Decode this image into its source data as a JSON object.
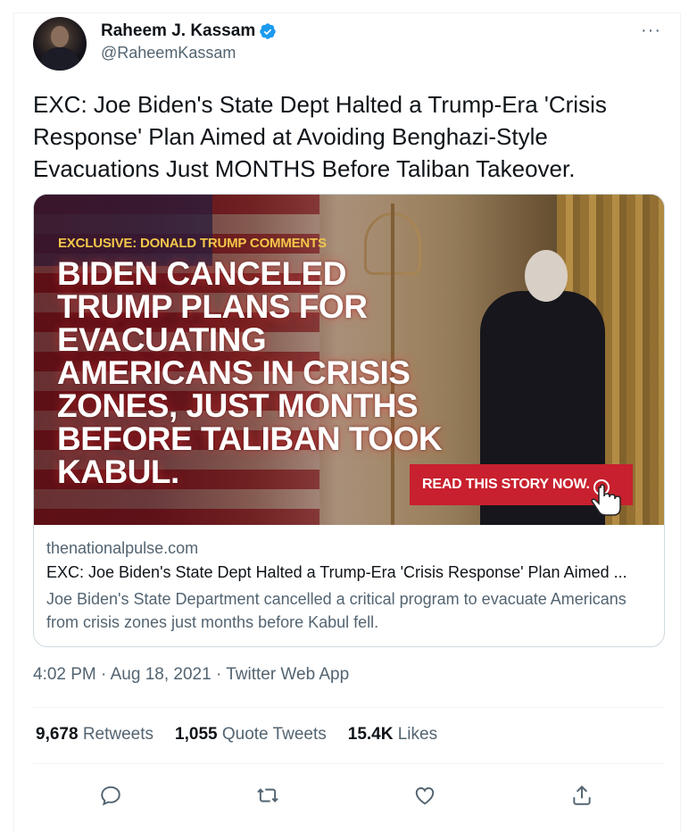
{
  "author": {
    "name": "Raheem J. Kassam",
    "handle": "@RaheemKassam"
  },
  "more_label": "···",
  "tweet_text": "EXC: Joe Biden's State Dept Halted a Trump-Era 'Crisis Response' Plan Aimed at Avoiding Benghazi-Style Evacuations Just MONTHS Before Taliban Takeover.",
  "card": {
    "image_kicker": "EXCLUSIVE: DONALD TRUMP COMMENTS",
    "image_headline": "BIDEN CANCELED TRUMP PLANS FOR EVACUATING AMERICANS IN CRISIS ZONES, JUST MONTHS BEFORE TALIBAN TOOK KABUL.",
    "image_button": "READ THIS STORY NOW.",
    "domain": "thenationalpulse.com",
    "title": "EXC: Joe Biden's State Dept Halted a Trump-Era 'Crisis Response' Plan Aimed ...",
    "description": "Joe Biden's State Department cancelled a critical program to evacuate Americans from crisis zones just months before Kabul fell."
  },
  "timestamp": {
    "time": "4:02 PM",
    "date": "Aug 18, 2021",
    "app": "Twitter Web App"
  },
  "stats": {
    "retweets_count": "9,678",
    "retweets_label": "Retweets",
    "quotes_count": "1,055",
    "quotes_label": "Quote Tweets",
    "likes_count": "15.4K",
    "likes_label": "Likes"
  },
  "colors": {
    "verified": "#1d9bf0",
    "secondary_text": "#536471",
    "read_button": "#c8202e"
  },
  "icons": [
    "verified-icon",
    "more-icon",
    "reply-icon",
    "retweet-icon",
    "like-icon",
    "share-icon",
    "hand-pointer-icon"
  ]
}
